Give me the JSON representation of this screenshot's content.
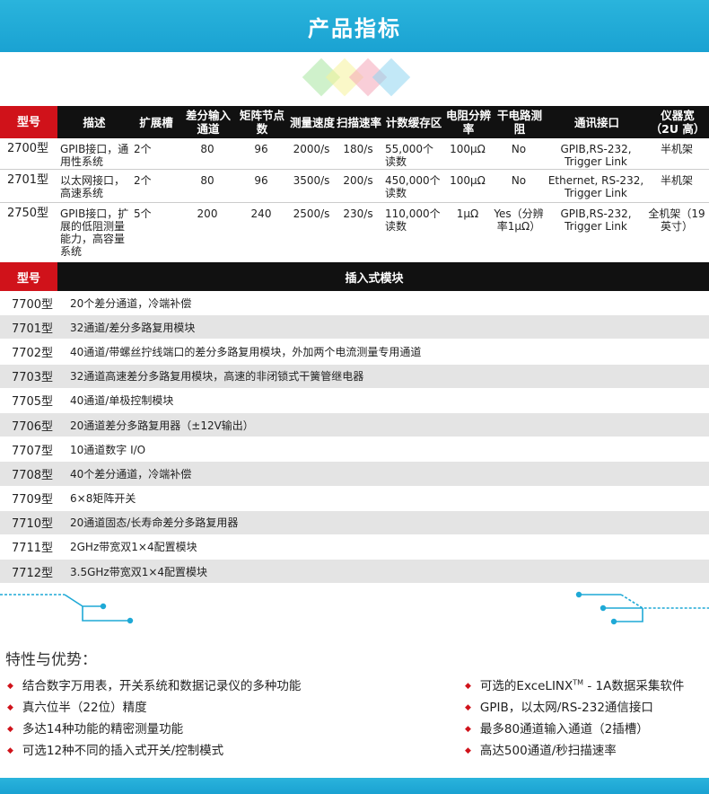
{
  "header": {
    "title": "产品指标"
  },
  "accent_colors": {
    "band": "#1fa9d6",
    "red": "#d0121a",
    "dark": "#111111",
    "diamonds": [
      "#a8e6a0",
      "#f6f29a",
      "#f4a6b8",
      "#8fd6f0"
    ]
  },
  "spec_table": {
    "headers": [
      "型号",
      "描述",
      "扩展槽",
      "差分输入通道",
      "矩阵节点数",
      "测量速度",
      "扫描速率",
      "计数缓存区",
      "电阻分辨率",
      "干电路测阻",
      "通讯接口",
      "仪器宽（2U 高）"
    ],
    "rows": [
      [
        "2700型",
        "GPIB接口，通用性系统",
        "2个",
        "80",
        "96",
        "2000/s",
        "180/s",
        "55,000个读数",
        "100μΩ",
        "No",
        "GPIB,RS-232, Trigger Link",
        "半机架"
      ],
      [
        "2701型",
        "以太网接口，高速系统",
        "2个",
        "80",
        "96",
        "3500/s",
        "200/s",
        "450,000个读数",
        "100μΩ",
        "No",
        "Ethernet, RS-232, Trigger Link",
        "半机架"
      ],
      [
        "2750型",
        "GPIB接口，扩展的低阻测量能力，高容量系统",
        "5个",
        "200",
        "240",
        "2500/s",
        "230/s",
        "110,000个读数",
        "1μΩ",
        "Yes（分辨率1μΩ）",
        "GPIB,RS-232, Trigger Link",
        "全机架（19英寸）"
      ]
    ]
  },
  "modules": {
    "header_label": "型号",
    "header_title": "插入式模块",
    "rows": [
      {
        "model": "7700型",
        "desc": "20个差分通道，冷端补偿"
      },
      {
        "model": "7701型",
        "desc": "32通道/差分多路复用模块"
      },
      {
        "model": "7702型",
        "desc": "40通道/带螺丝拧线端口的差分多路复用模块，外加两个电流测量专用通道"
      },
      {
        "model": "7703型",
        "desc": "32通道高速差分多路复用模块，高速的非闭锁式干簧管继电器"
      },
      {
        "model": "7705型",
        "desc": "40通道/单极控制模块"
      },
      {
        "model": "7706型",
        "desc": "20通道差分多路复用器（±12V输出）"
      },
      {
        "model": "7707型",
        "desc": "10通道数字 I/O"
      },
      {
        "model": "7708型",
        "desc": "40个差分通道，冷端补偿"
      },
      {
        "model": "7709型",
        "desc": "6×8矩阵开关"
      },
      {
        "model": "7710型",
        "desc": "20通道固态/长寿命差分多路复用器"
      },
      {
        "model": "7711型",
        "desc": "2GHz带宽双1×4配置模块"
      },
      {
        "model": "7712型",
        "desc": "3.5GHz带宽双1×4配置模块"
      }
    ]
  },
  "features": {
    "title": "特性与优势：",
    "left": [
      "结合数字万用表，开关系统和数据记录仪的多种功能",
      "真六位半（22位）精度",
      "多达14种功能的精密测量功能",
      "可选12种不同的插入式开关/控制模式"
    ],
    "right_first_pre": "可选的ExceLINX",
    "right_first_sup": "TM",
    "right_first_post": " - 1A数据采集软件",
    "right": [
      "GPIB，以太网/RS-232通信接口",
      "最多80通道输入通道（2插槽）",
      "高达500通道/秒扫描速率"
    ]
  }
}
